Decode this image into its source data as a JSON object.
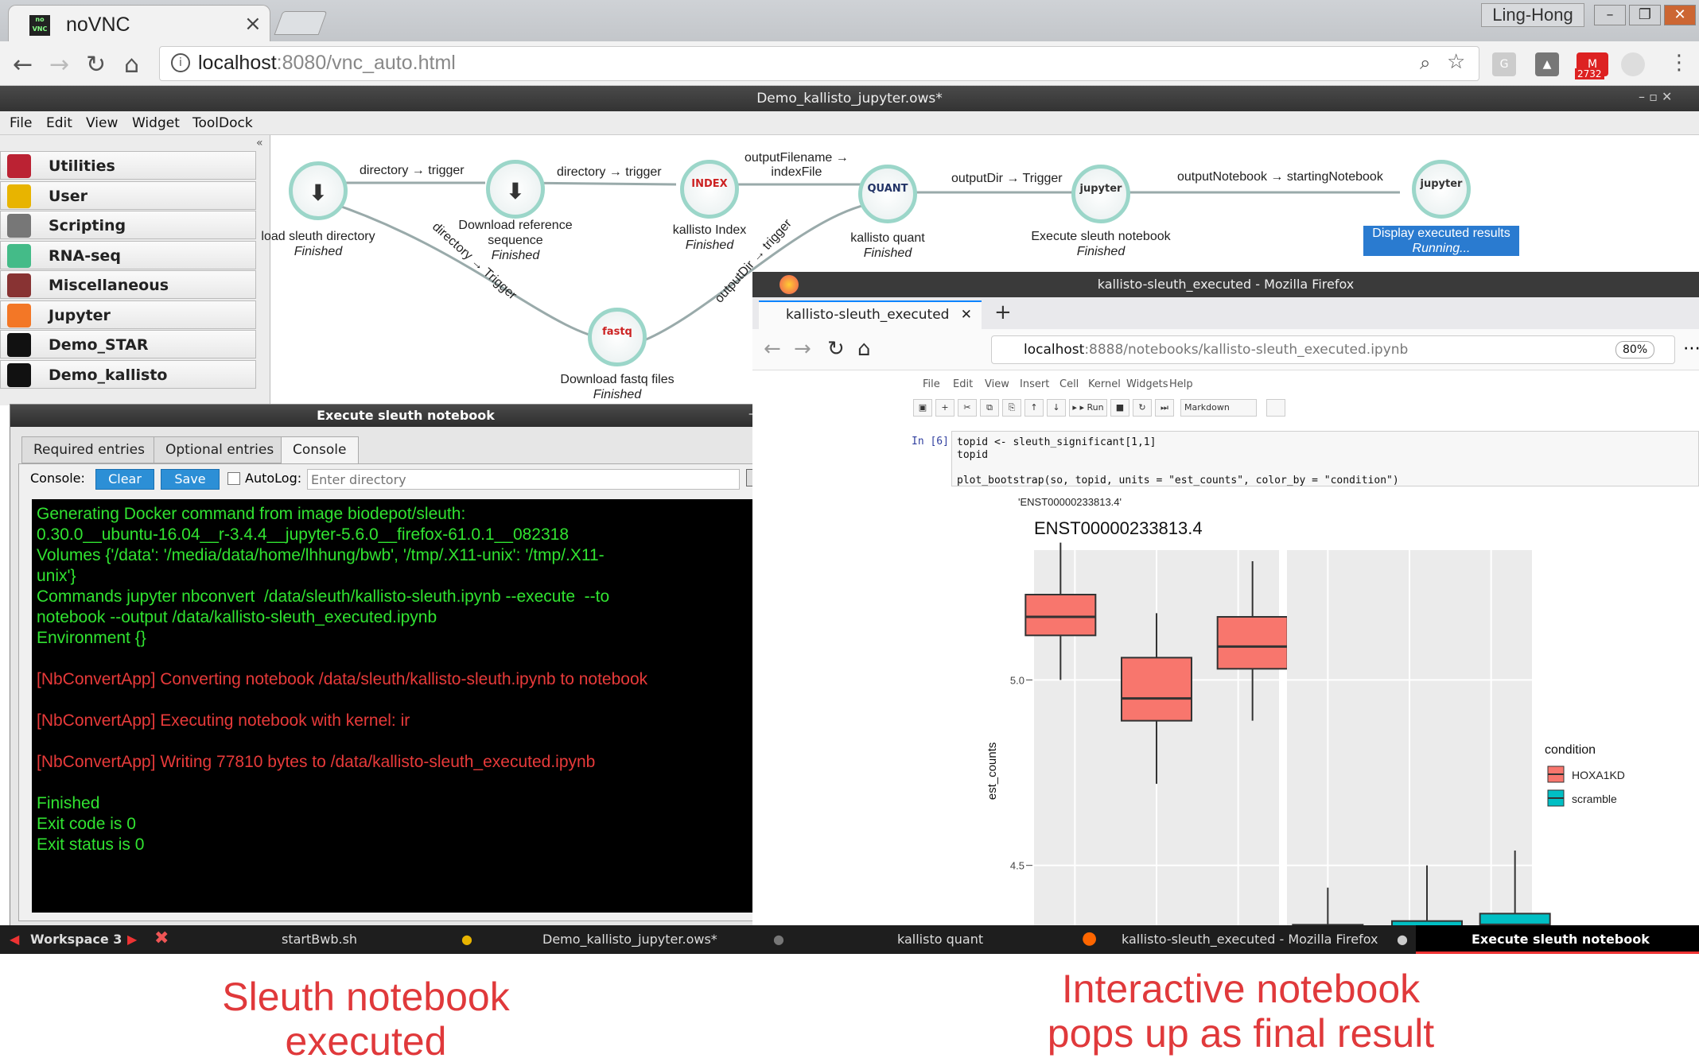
{
  "chrome": {
    "tab_title": "noVNC",
    "tab_favicon_text": "no\nVNC",
    "profile": "Ling-Hong",
    "url_host": "localhost",
    "url_rest": ":8080/vnc_auto.html",
    "mail_badge": "2732"
  },
  "vnc": {
    "window_title": "Demo_kallisto_jupyter.ows*",
    "menu": [
      "File",
      "Edit",
      "View",
      "Widget",
      "ToolDock"
    ]
  },
  "toolbox": {
    "items": [
      {
        "label": "Utilities",
        "icon": "wrench-icon",
        "color": "#b23"
      },
      {
        "label": "User",
        "icon": "lightbulb-icon",
        "color": "#e8b400"
      },
      {
        "label": "Scripting",
        "icon": "scroll-icon",
        "color": "#777"
      },
      {
        "label": "RNA-seq",
        "icon": "dna-icon",
        "color": "#4b8"
      },
      {
        "label": "Miscellaneous",
        "icon": "books-icon",
        "color": "#833"
      },
      {
        "label": "Jupyter",
        "icon": "jupyter-icon",
        "color": "#f37726"
      },
      {
        "label": "Demo_STAR",
        "icon": "star-icon",
        "color": "#111"
      },
      {
        "label": "Demo_kallisto",
        "icon": "bear-icon",
        "color": "#111"
      }
    ]
  },
  "workflow": {
    "nodes": [
      {
        "name": "load sleuth directory",
        "status": "Finished"
      },
      {
        "name": "Download reference\nsequence",
        "status": "Finished"
      },
      {
        "name": "kallisto Index",
        "status": "Finished"
      },
      {
        "name": "kallisto quant",
        "status": "Finished"
      },
      {
        "name": "Execute sleuth notebook",
        "status": "Finished"
      },
      {
        "name": "Display executed results",
        "status": "Running..."
      },
      {
        "name": "Download fastq files",
        "status": "Finished"
      }
    ],
    "links": [
      "directory → trigger",
      "directory → trigger",
      "outputFilename →\nindexFile",
      "outputDir → Trigger",
      "outputNotebook → startingNotebook",
      "directory → Trigger",
      "outputDir → trigger"
    ],
    "node_badges": {
      "index": "INDEX",
      "quant": "QUANT",
      "fastq": "fastq"
    }
  },
  "dialog": {
    "title": "Execute sleuth notebook",
    "tabs": [
      "Required entries",
      "Optional entries",
      "Console"
    ],
    "console_label": "Console:",
    "clear": "Clear",
    "save": "Save",
    "autolog": "AutoLog:",
    "dir_placeholder": "Enter directory",
    "console_lines": [
      {
        "text": "Generating Docker command from image biodepot/sleuth:\n0.30.0__ubuntu-16.04__r-3.4.4__jupyter-5.6.0__firefox-61.0.1__082318\nVolumes {'/data': '/media/data/home/lhhung/bwb', '/tmp/.X11-unix': '/tmp/.X11-\nunix'}\nCommands jupyter nbconvert  /data/sleuth/kallisto-sleuth.ipynb --execute  --to\nnotebook --output /data/kallisto-sleuth_executed.ipynb\nEnvironment {}\n",
        "kind": "ok"
      },
      {
        "text": "[NbConvertApp] Converting notebook /data/sleuth/kallisto-sleuth.ipynb to notebook\n",
        "kind": "err"
      },
      {
        "text": "[NbConvertApp] Executing notebook with kernel: ir\n",
        "kind": "err"
      },
      {
        "text": "[NbConvertApp] Writing 77810 bytes to /data/kallisto-sleuth_executed.ipynb\n",
        "kind": "err"
      },
      {
        "text": "Finished\nExit code is 0\nExit status is 0",
        "kind": "ok"
      }
    ]
  },
  "firefox": {
    "window_title": "kallisto-sleuth_executed - Mozilla Firefox",
    "tab_title": "kallisto-sleuth_executed",
    "url_host": "localhost",
    "url_rest": ":8888/notebooks/kallisto-sleuth_executed.ipynb",
    "zoom": "80%",
    "nb_menu": [
      "File",
      "Edit",
      "View",
      "Insert",
      "Cell",
      "Kernel",
      "Widgets",
      "Help"
    ],
    "cell_type": "Markdown",
    "run_label": "Run",
    "prompt": "In [6]:",
    "code": "topid <- sleuth_significant[1,1]\ntopid\n\nplot_bootstrap(so, topid, units = \"est_counts\", color_by = \"condition\")",
    "output_text": "'ENST00000233813.4'"
  },
  "chart_data": {
    "type": "boxplot",
    "title": "ENST00000233813.4",
    "ylabel": "est_counts",
    "yticks": [
      4.5,
      5.0
    ],
    "ylim": [
      4.33,
      5.35
    ],
    "legend_title": "condition",
    "legend_position": "right",
    "series": [
      {
        "name": "HOXA1KD",
        "color": "#f8766d"
      },
      {
        "name": "scramble",
        "color": "#00bfc4"
      }
    ],
    "panels": [
      {
        "boxes": [
          {
            "group": "HOXA1KD",
            "min": 5.0,
            "q1": 5.12,
            "median": 5.17,
            "q3": 5.23,
            "max": 5.37
          },
          {
            "group": "HOXA1KD",
            "min": 4.72,
            "q1": 4.89,
            "median": 4.95,
            "q3": 5.06,
            "max": 5.18
          },
          {
            "group": "HOXA1KD",
            "min": 4.89,
            "q1": 5.03,
            "median": 5.09,
            "q3": 5.17,
            "max": 5.32
          }
        ]
      },
      {
        "boxes": [
          {
            "group": "scramble",
            "min": 4.33,
            "q1": 4.31,
            "median": 4.33,
            "q3": 4.34,
            "max": 4.44
          },
          {
            "group": "scramble",
            "min": 4.31,
            "q1": 4.32,
            "median": 4.33,
            "q3": 4.35,
            "max": 4.5
          },
          {
            "group": "scramble",
            "min": 4.31,
            "q1": 4.33,
            "median": 4.34,
            "q3": 4.37,
            "max": 4.54
          }
        ]
      }
    ]
  },
  "taskbar": {
    "workspace": "Workspace 3",
    "items": [
      "startBwb.sh",
      "Demo_kallisto_jupyter.ows*",
      "kallisto quant",
      "kallisto-sleuth_executed - Mozilla Firefox",
      "Execute sleuth notebook"
    ]
  },
  "captions": {
    "left": "Sleuth notebook executed",
    "right": "Interactive notebook pops up as final result"
  }
}
